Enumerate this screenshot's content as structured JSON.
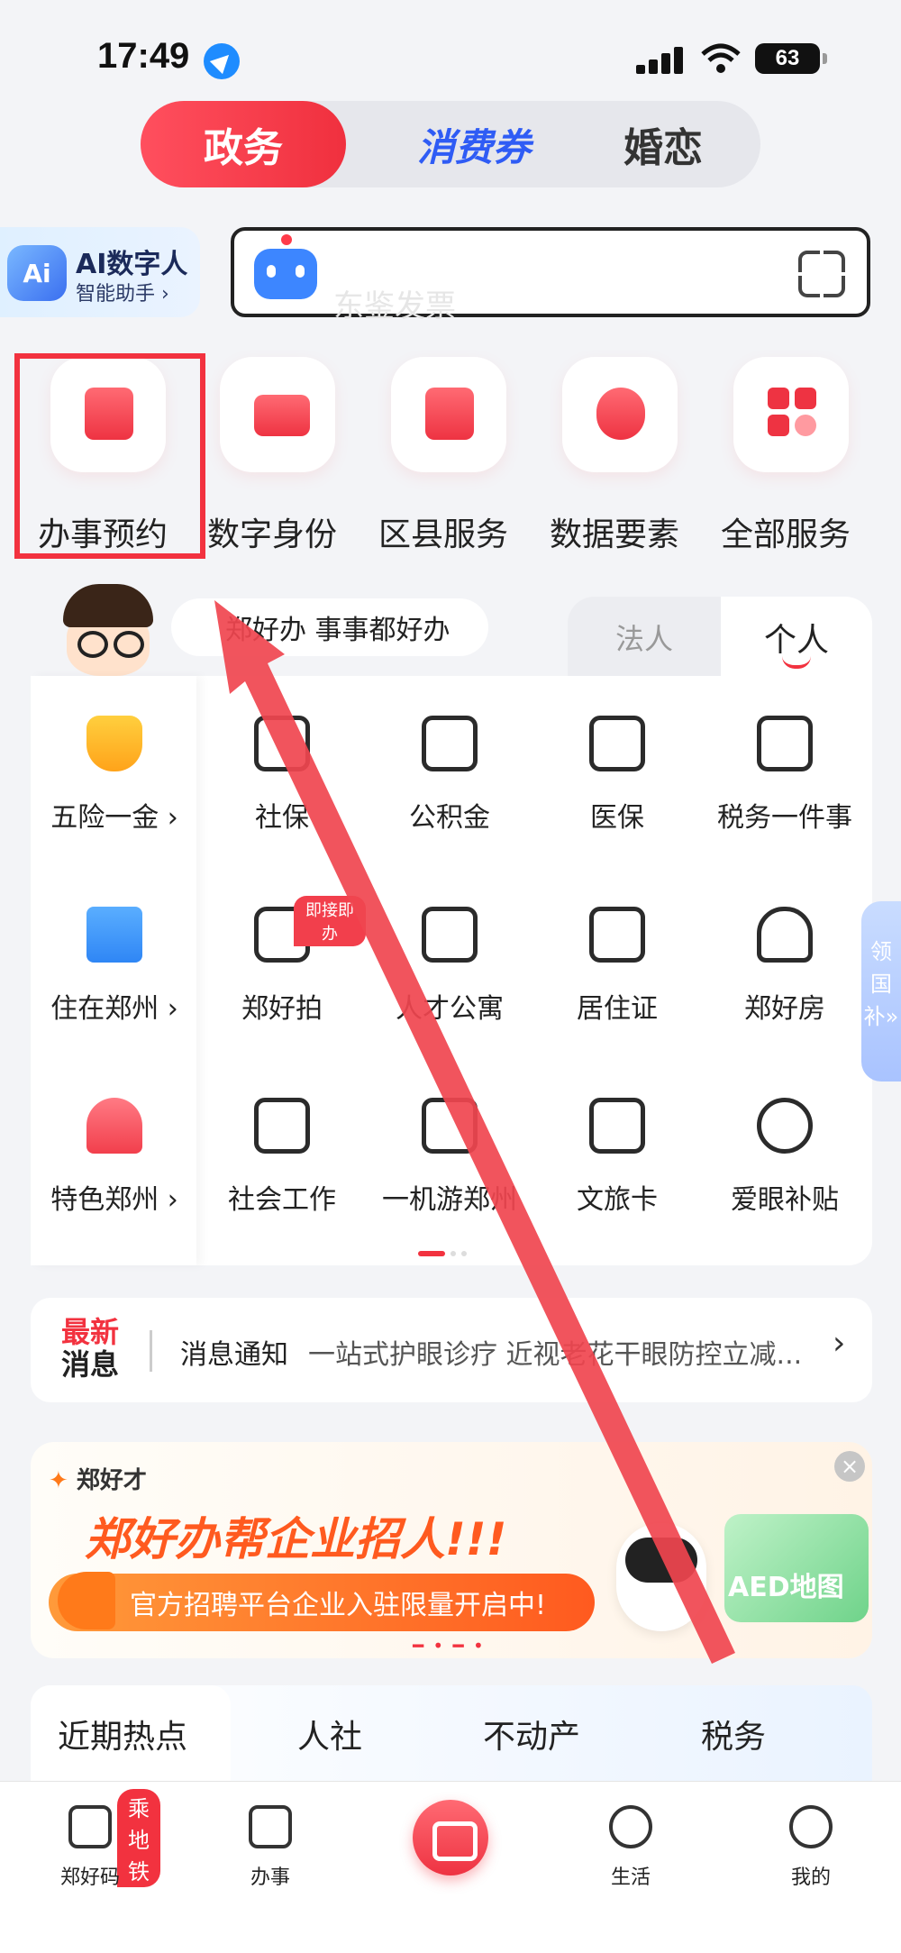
{
  "status_bar": {
    "time": "17:49",
    "battery": "63"
  },
  "top_tabs": {
    "active": "政务",
    "coupon": "消费券",
    "love": "婚恋"
  },
  "ai_assistant": {
    "title": "AI数字人",
    "subtitle": "智能助手 ›",
    "logo_text": "Ai"
  },
  "search": {
    "placeholder": "东鉴发票"
  },
  "services": [
    {
      "label": "办事预约"
    },
    {
      "label": "数字身份"
    },
    {
      "label": "区县服务"
    },
    {
      "label": "数据要素"
    },
    {
      "label": "全部服务"
    }
  ],
  "slogan": "郑好办  事事都好办",
  "role_tabs": {
    "legal": "法人",
    "personal": "个人"
  },
  "grid": {
    "rows": [
      [
        {
          "label": "五险一金 ›"
        },
        {
          "label": "社保"
        },
        {
          "label": "公积金"
        },
        {
          "label": "医保"
        },
        {
          "label": "税务一件事"
        }
      ],
      [
        {
          "label": "住在郑州 ›"
        },
        {
          "label": "郑好拍"
        },
        {
          "label": "人才公寓"
        },
        {
          "label": "居住证"
        },
        {
          "label": "郑好房"
        }
      ],
      [
        {
          "label": "特色郑州 ›"
        },
        {
          "label": "社会工作"
        },
        {
          "label": "一机游郑州"
        },
        {
          "label": "文旅卡"
        },
        {
          "label": "爱眼补贴"
        }
      ]
    ],
    "badge": "即接即办"
  },
  "side_tag": "领国补»",
  "news": {
    "tag_top": "最新",
    "tag_bottom": "消息",
    "title": "消息通知",
    "text": "一站式护眼诊疗 近视老花干眼防控立减...",
    "chevron": "›"
  },
  "banner": {
    "brand": "郑好才",
    "headline": "郑好办帮企业招人!!!",
    "subline": "官方招聘平台企业入驻限量开启中!",
    "side": "AED地图",
    "close": "×",
    "dots": "━ • ━ •"
  },
  "hot_topics": {
    "tabs": [
      "近期热点",
      "人社",
      "不动产",
      "税务"
    ]
  },
  "bottom_nav": {
    "items": [
      {
        "label": "郑好码",
        "badge": "乘地铁"
      },
      {
        "label": "办事"
      },
      {
        "label": "生活"
      },
      {
        "label": "我的"
      }
    ]
  },
  "colors": {
    "accent": "#f2323f",
    "coupon_blue": "#2f5cf5",
    "annotation_red": "#f0454f"
  }
}
